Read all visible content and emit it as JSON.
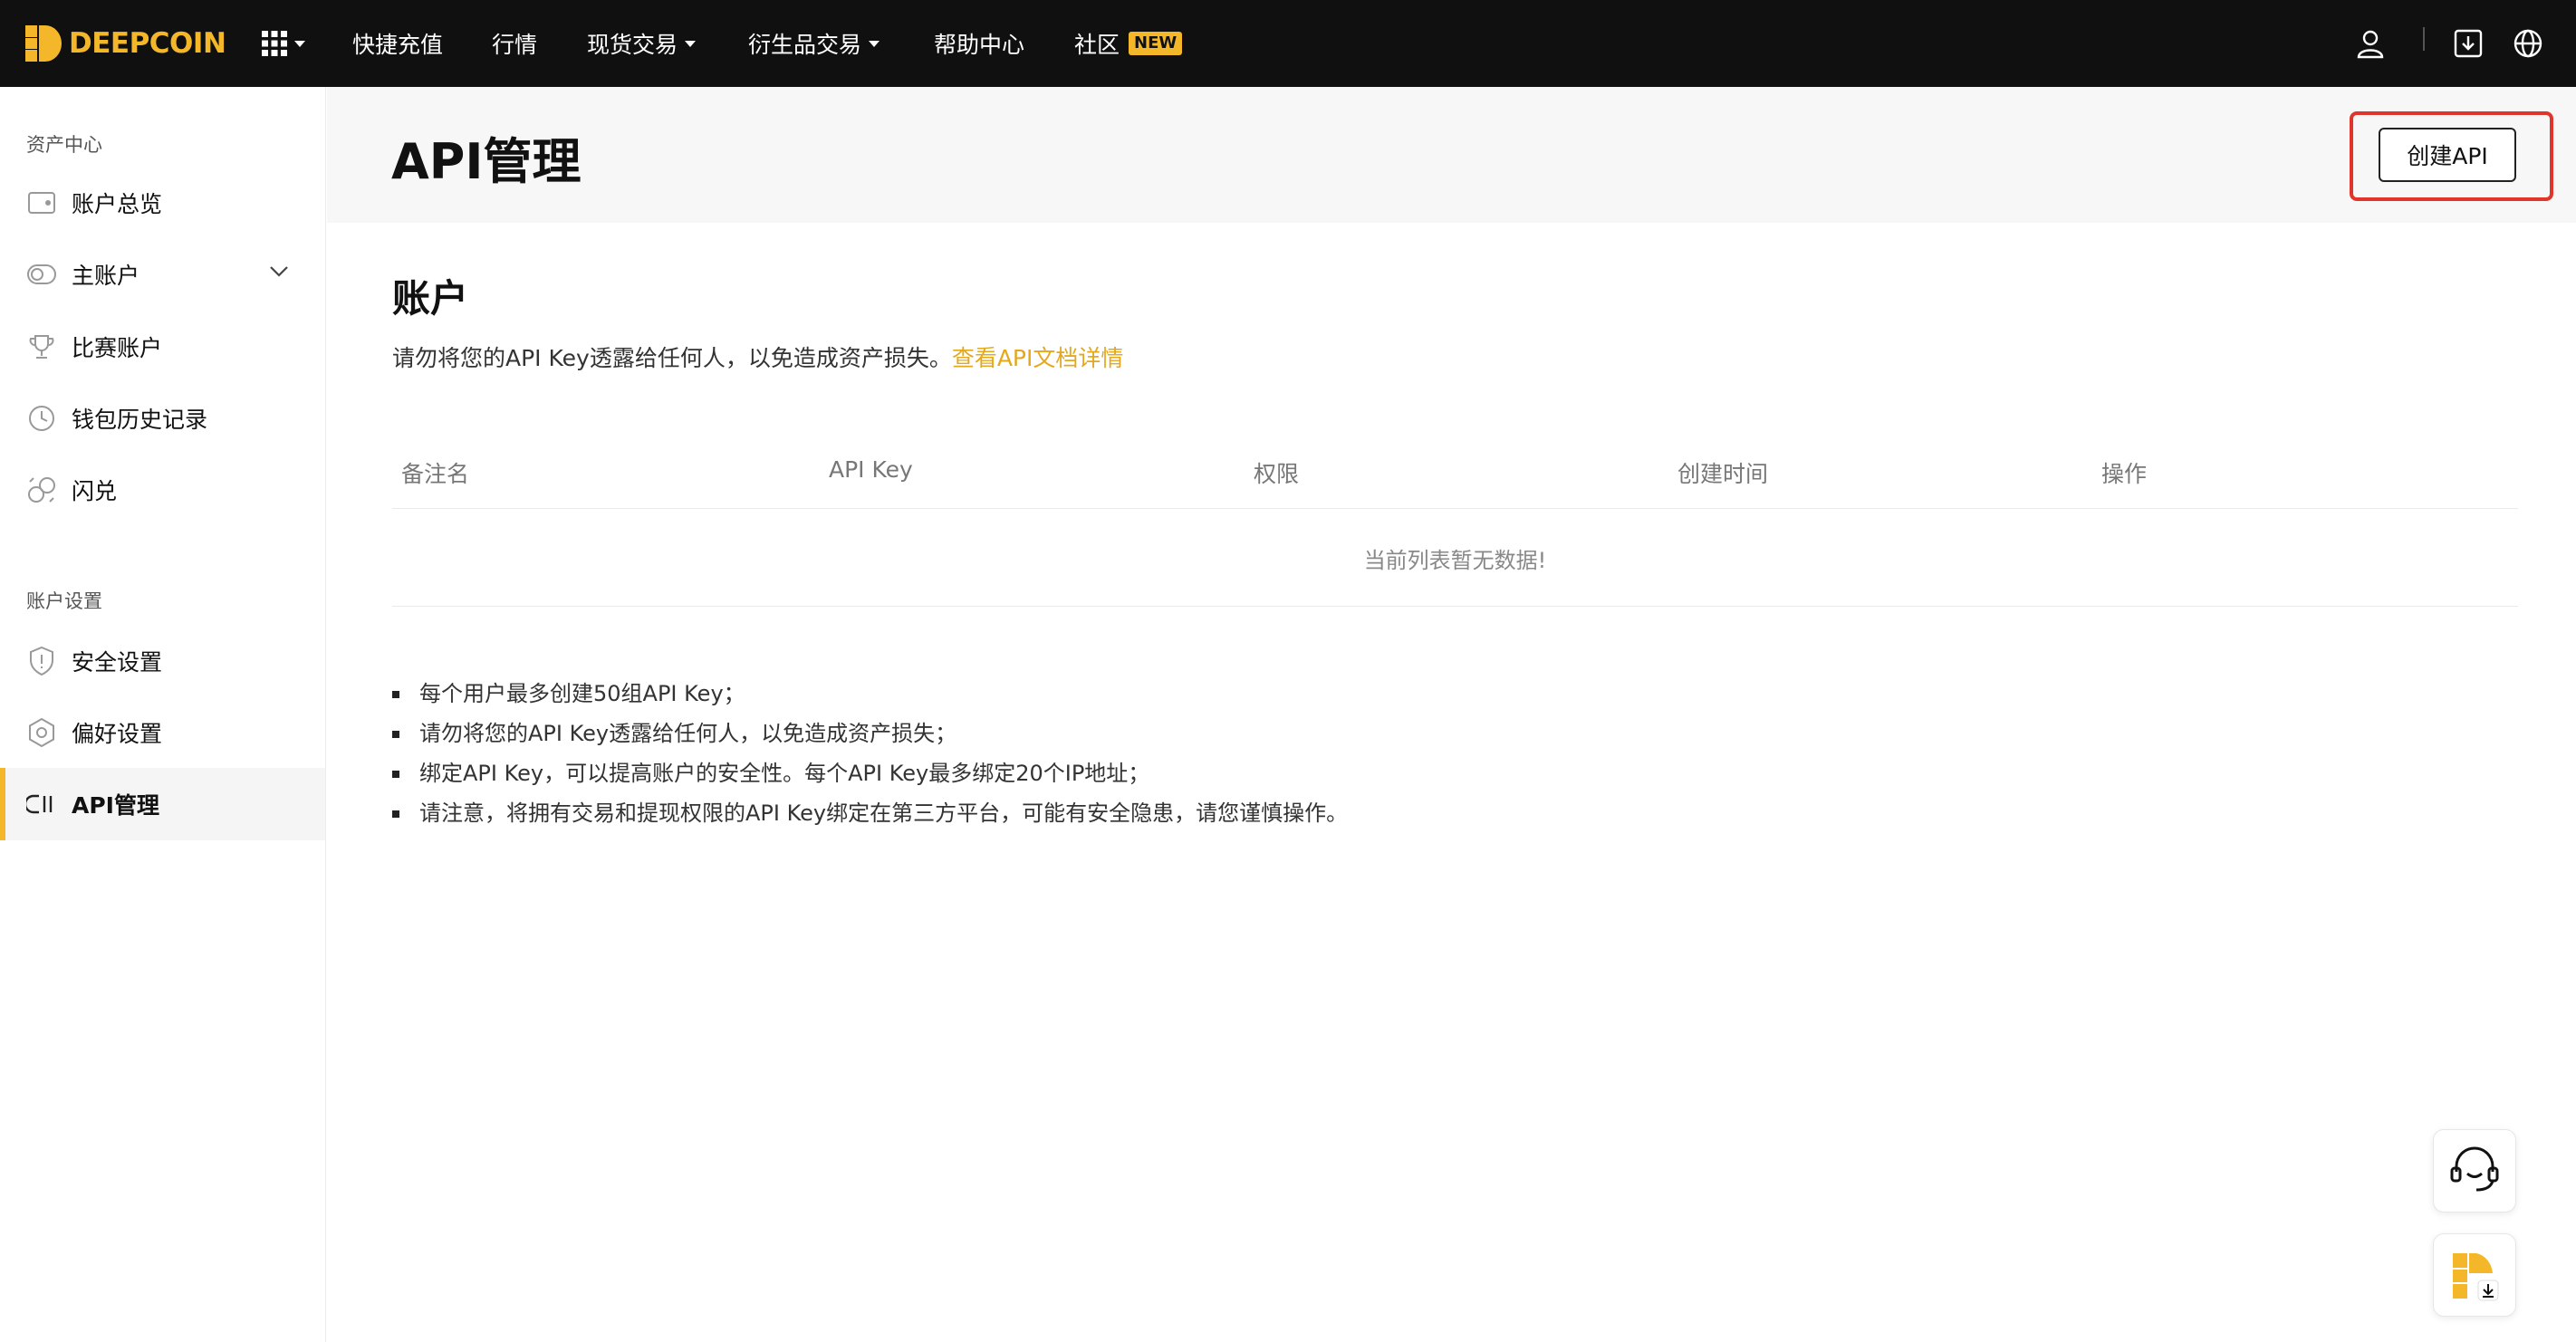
{
  "brand": {
    "name": "DEEPCOIN",
    "accent": "#f5b72a",
    "alert_red": "#e0352b"
  },
  "topnav": {
    "items": [
      {
        "label": "快捷充值",
        "dropdown": false
      },
      {
        "label": "行情",
        "dropdown": false
      },
      {
        "label": "现货交易",
        "dropdown": true
      },
      {
        "label": "衍生品交易",
        "dropdown": true
      },
      {
        "label": "帮助中心",
        "dropdown": false
      },
      {
        "label": "社区",
        "dropdown": false,
        "badge": "NEW"
      }
    ],
    "icons": [
      "apps-grid-icon",
      "user-icon",
      "download-icon",
      "globe-icon"
    ]
  },
  "sidebar": {
    "groups": [
      {
        "title": "资产中心",
        "items": [
          {
            "label": "账户总览",
            "icon": "wallet-icon"
          },
          {
            "label": "主账户",
            "icon": "toggle-icon",
            "expandable": true
          },
          {
            "label": "比赛账户",
            "icon": "trophy-icon"
          },
          {
            "label": "钱包历史记录",
            "icon": "clock-icon"
          },
          {
            "label": "闪兑",
            "icon": "exchange-icon"
          }
        ]
      },
      {
        "title": "账户设置",
        "items": [
          {
            "label": "安全设置",
            "icon": "shield-icon"
          },
          {
            "label": "偏好设置",
            "icon": "hexagon-icon"
          },
          {
            "label": "API管理",
            "icon": "api-icon",
            "active": true
          }
        ]
      }
    ]
  },
  "page": {
    "title": "API管理",
    "create_button": "创建API"
  },
  "account_section": {
    "title": "账户",
    "notice": "请勿将您的API Key透露给任何人，以免造成资产损失。",
    "doc_link": "查看API文档详情"
  },
  "table": {
    "columns": [
      "备注名",
      "API Key",
      "权限",
      "创建时间",
      "操作"
    ],
    "empty_text": "当前列表暂无数据!"
  },
  "tips": [
    "每个用户最多创建50组API Key；",
    "请勿将您的API Key透露给任何人，以免造成资产损失；",
    "绑定API Key，可以提高账户的安全性。每个API Key最多绑定20个IP地址；",
    "请注意，将拥有交易和提现权限的API Key绑定在第三方平台，可能有安全隐患，请您谨慎操作。"
  ],
  "floating": [
    "customer-service-icon",
    "app-download-icon"
  ]
}
